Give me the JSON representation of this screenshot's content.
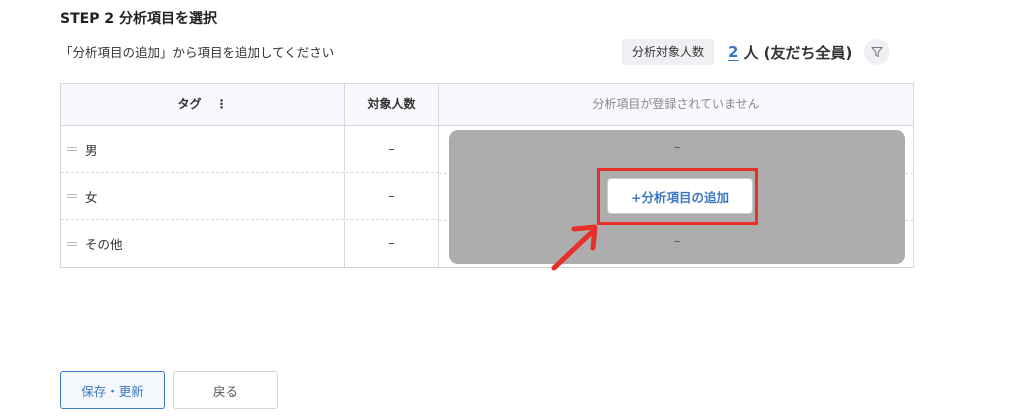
{
  "step_title": "STEP 2 分析項目を選択",
  "instruction": "「分析項目の追加」から項目を追加してください",
  "target_count": {
    "label": "分析対象人数",
    "value": "2",
    "unit": "人 (友だち全員)",
    "filter_icon": "filter-icon"
  },
  "table": {
    "headers": {
      "tag": "タグ",
      "tag_menu": "⋮",
      "count": "対象人数",
      "empty_message": "分析項目が登録されていません"
    },
    "rows": [
      {
        "tag": "男",
        "count": "–",
        "value": "–"
      },
      {
        "tag": "女",
        "count": "–",
        "value": ""
      },
      {
        "tag": "その他",
        "count": "–",
        "value": "–"
      }
    ]
  },
  "add_item_button": "+分析項目の追加",
  "footer": {
    "save_label": "保存・更新",
    "back_label": "戻る"
  },
  "colors": {
    "accent": "#3a78c4",
    "highlight": "#e8302a",
    "overlay": "#adadad"
  }
}
